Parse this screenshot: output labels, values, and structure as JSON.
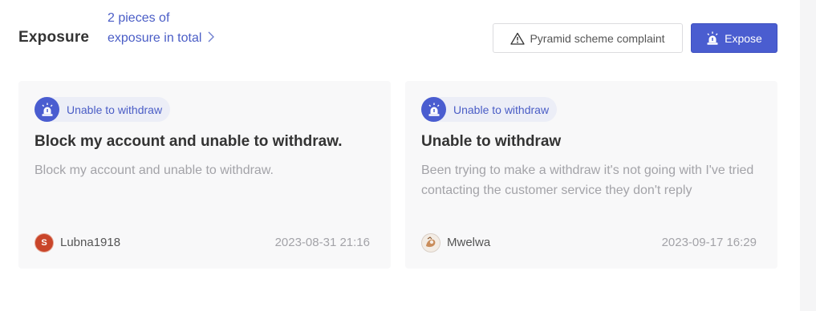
{
  "header": {
    "title": "Exposure",
    "count_text": "2 pieces of exposure in total",
    "complaint_button_label": "Pyramid scheme complaint",
    "expose_button_label": "Expose"
  },
  "cards": [
    {
      "tag": "Unable to withdraw",
      "title": "Block my account and unable to withdraw.",
      "body": "Block my account and unable to withdraw.",
      "author_initial": "S",
      "author": "Lubna1918",
      "date": "2023-08-31 21:16"
    },
    {
      "tag": "Unable to withdraw",
      "title": "Unable to withdraw",
      "body": "Been trying to make a withdraw it's not going with I've tried contacting the customer service they don't reply",
      "author": "Mwelwa",
      "date": "2023-09-17 16:29"
    }
  ],
  "colors": {
    "accent": "#4a5dd0",
    "tag_background": "#eceef7",
    "card_background": "#f8f8f9"
  },
  "icons": {
    "chevron": "chevron-right-icon",
    "complaint": "warning-triangle-icon",
    "expose": "alarm-siren-icon"
  }
}
